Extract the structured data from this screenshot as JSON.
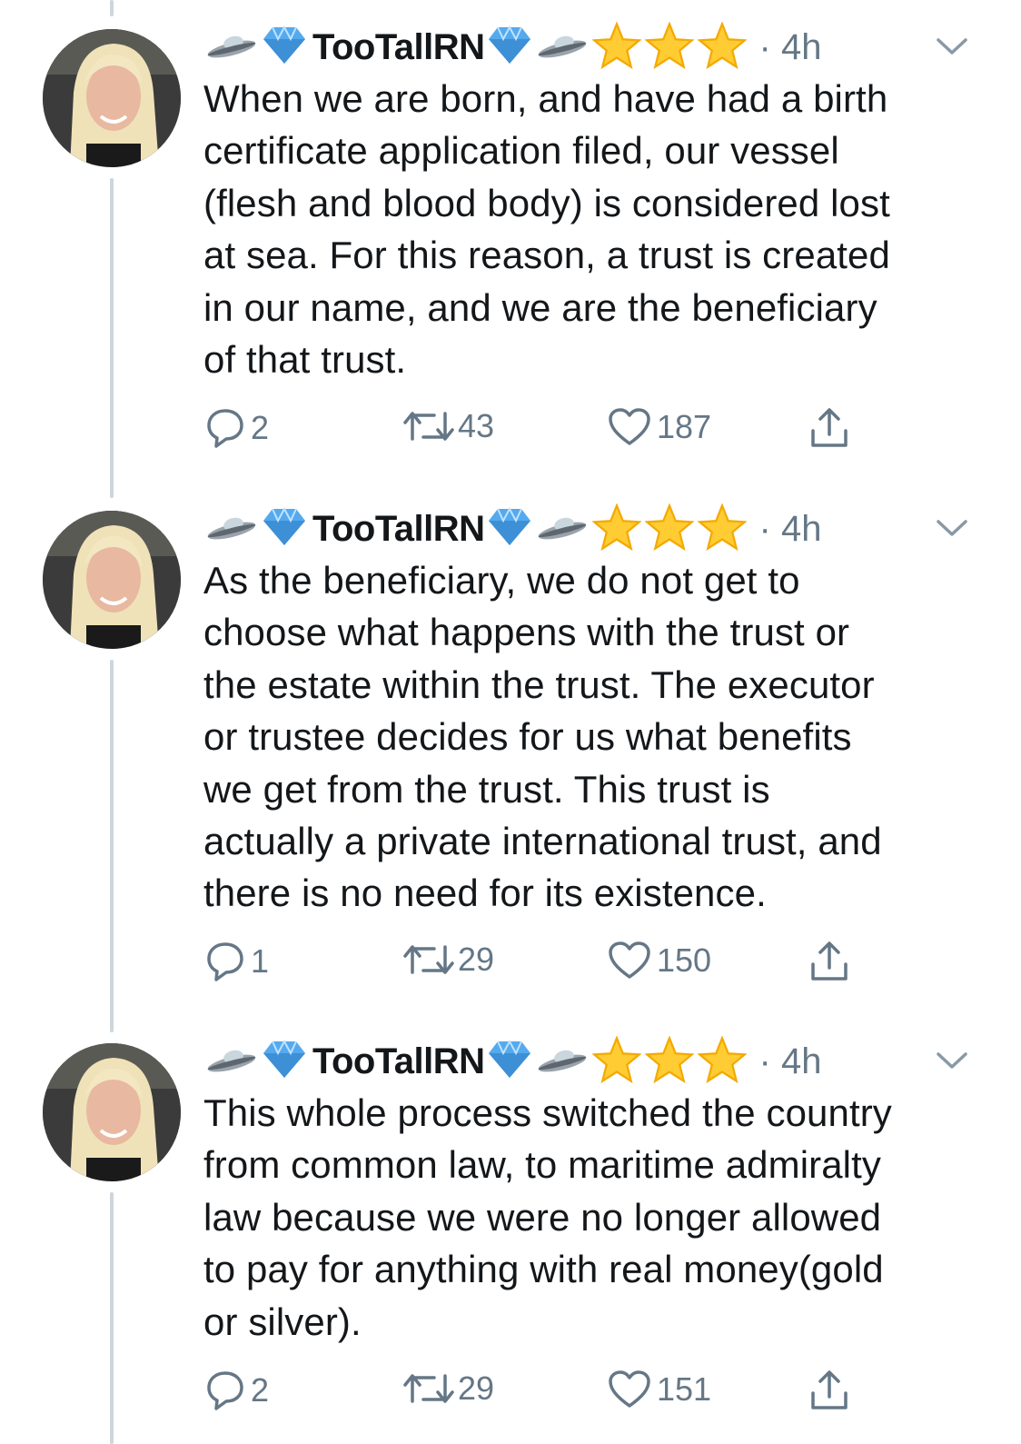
{
  "colors": {
    "text": "#14171a",
    "muted": "#657786",
    "thread_line": "#ccd6dd",
    "star": "#ffcc33",
    "gem": "#55aaee"
  },
  "icons": [
    "ufo-icon",
    "gem-icon",
    "star-icon",
    "chevron-down-icon",
    "reply-icon",
    "retweet-icon",
    "like-icon",
    "share-icon"
  ],
  "tweets": [
    {
      "username": "TooTallRN",
      "time": "· 4h",
      "lines": [
        "When we are born, and have had a birth",
        "certificate application filed, our vessel",
        "(flesh and blood body) is considered lost",
        "at sea. For this reason, a trust is created",
        "in our name, and we are the beneficiary",
        "of that trust."
      ],
      "replies": "2",
      "retweets": "43",
      "likes": "187"
    },
    {
      "username": "TooTallRN",
      "time": "· 4h",
      "lines": [
        "As the beneficiary, we do not get to",
        "choose what happens with the trust or",
        "the estate within the trust. The executor",
        "or trustee decides for us what benefits",
        "we get from the trust. This trust is",
        "actually a private international trust, and",
        "there is no need for its existence."
      ],
      "replies": "1",
      "retweets": "29",
      "likes": "150"
    },
    {
      "username": "TooTallRN",
      "time": "· 4h",
      "lines": [
        "This whole process switched the country",
        "from common law, to maritime admiralty",
        "law because we were no longer allowed",
        "to pay for anything with real money(gold",
        "or silver)."
      ],
      "replies": "2",
      "retweets": "29",
      "likes": "151"
    }
  ]
}
